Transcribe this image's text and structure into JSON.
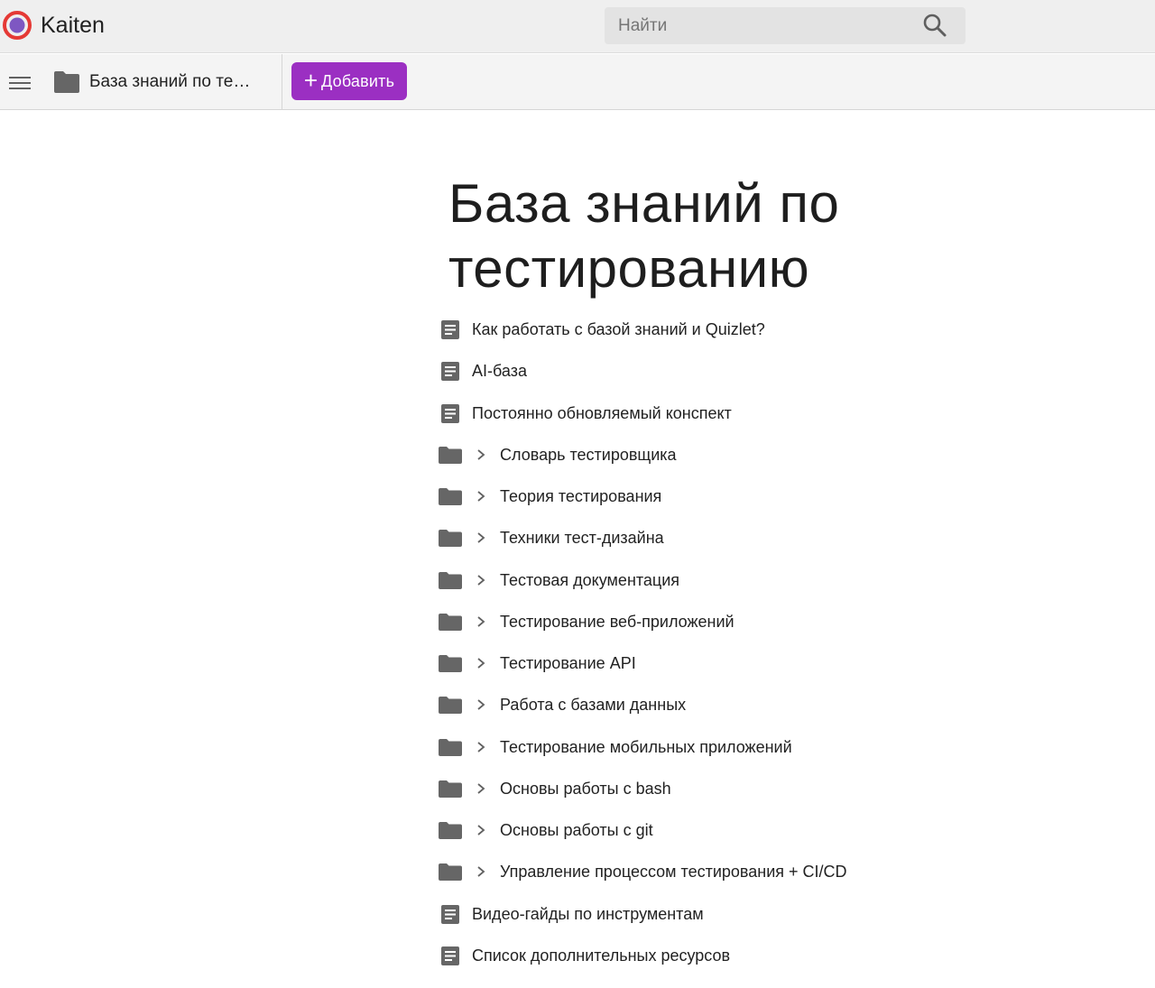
{
  "app": {
    "brand": "Kaiten",
    "logo_colors": {
      "outer": "#e53935",
      "inner": "#7e57c2"
    }
  },
  "search": {
    "placeholder": "Найти",
    "icon": "search-icon"
  },
  "toolbar": {
    "menu_icon": "hamburger-menu-icon",
    "breadcrumb_label": "База знаний по те…",
    "breadcrumb_icon": "folder-icon",
    "add_button": {
      "plus": "+",
      "label": "Добавить",
      "color": "#9b2fc2"
    }
  },
  "page": {
    "title_line1": "База знаний по",
    "title_line2": "тестированию",
    "items": [
      {
        "type": "document",
        "icon": "document-icon",
        "label": "Как работать с базой знаний и Quizlet?"
      },
      {
        "type": "document",
        "icon": "document-icon",
        "label": "AI-база"
      },
      {
        "type": "document",
        "icon": "document-icon",
        "label": "Постоянно обновляемый конспект"
      },
      {
        "type": "folder",
        "icon": "folder-icon",
        "label": "Словарь тестировщика"
      },
      {
        "type": "folder",
        "icon": "folder-icon",
        "label": "Теория тестирования"
      },
      {
        "type": "folder",
        "icon": "folder-icon",
        "label": "Техники тест-дизайна"
      },
      {
        "type": "folder",
        "icon": "folder-icon",
        "label": "Тестовая документация"
      },
      {
        "type": "folder",
        "icon": "folder-icon",
        "label": "Тестирование веб-приложений"
      },
      {
        "type": "folder",
        "icon": "folder-icon",
        "label": "Тестирование API"
      },
      {
        "type": "folder",
        "icon": "folder-icon",
        "label": "Работа с базами данных"
      },
      {
        "type": "folder",
        "icon": "folder-icon",
        "label": "Тестирование мобильных приложений"
      },
      {
        "type": "folder",
        "icon": "folder-icon",
        "label": "Основы работы с bash"
      },
      {
        "type": "folder",
        "icon": "folder-icon",
        "label": "Основы работы с git"
      },
      {
        "type": "folder",
        "icon": "folder-icon",
        "label": "Управление процессом тестирования + CI/CD"
      },
      {
        "type": "document",
        "icon": "document-icon",
        "label": "Видео-гайды по инструментам"
      },
      {
        "type": "document",
        "icon": "document-icon",
        "label": "Список дополнительных ресурсов"
      }
    ]
  }
}
